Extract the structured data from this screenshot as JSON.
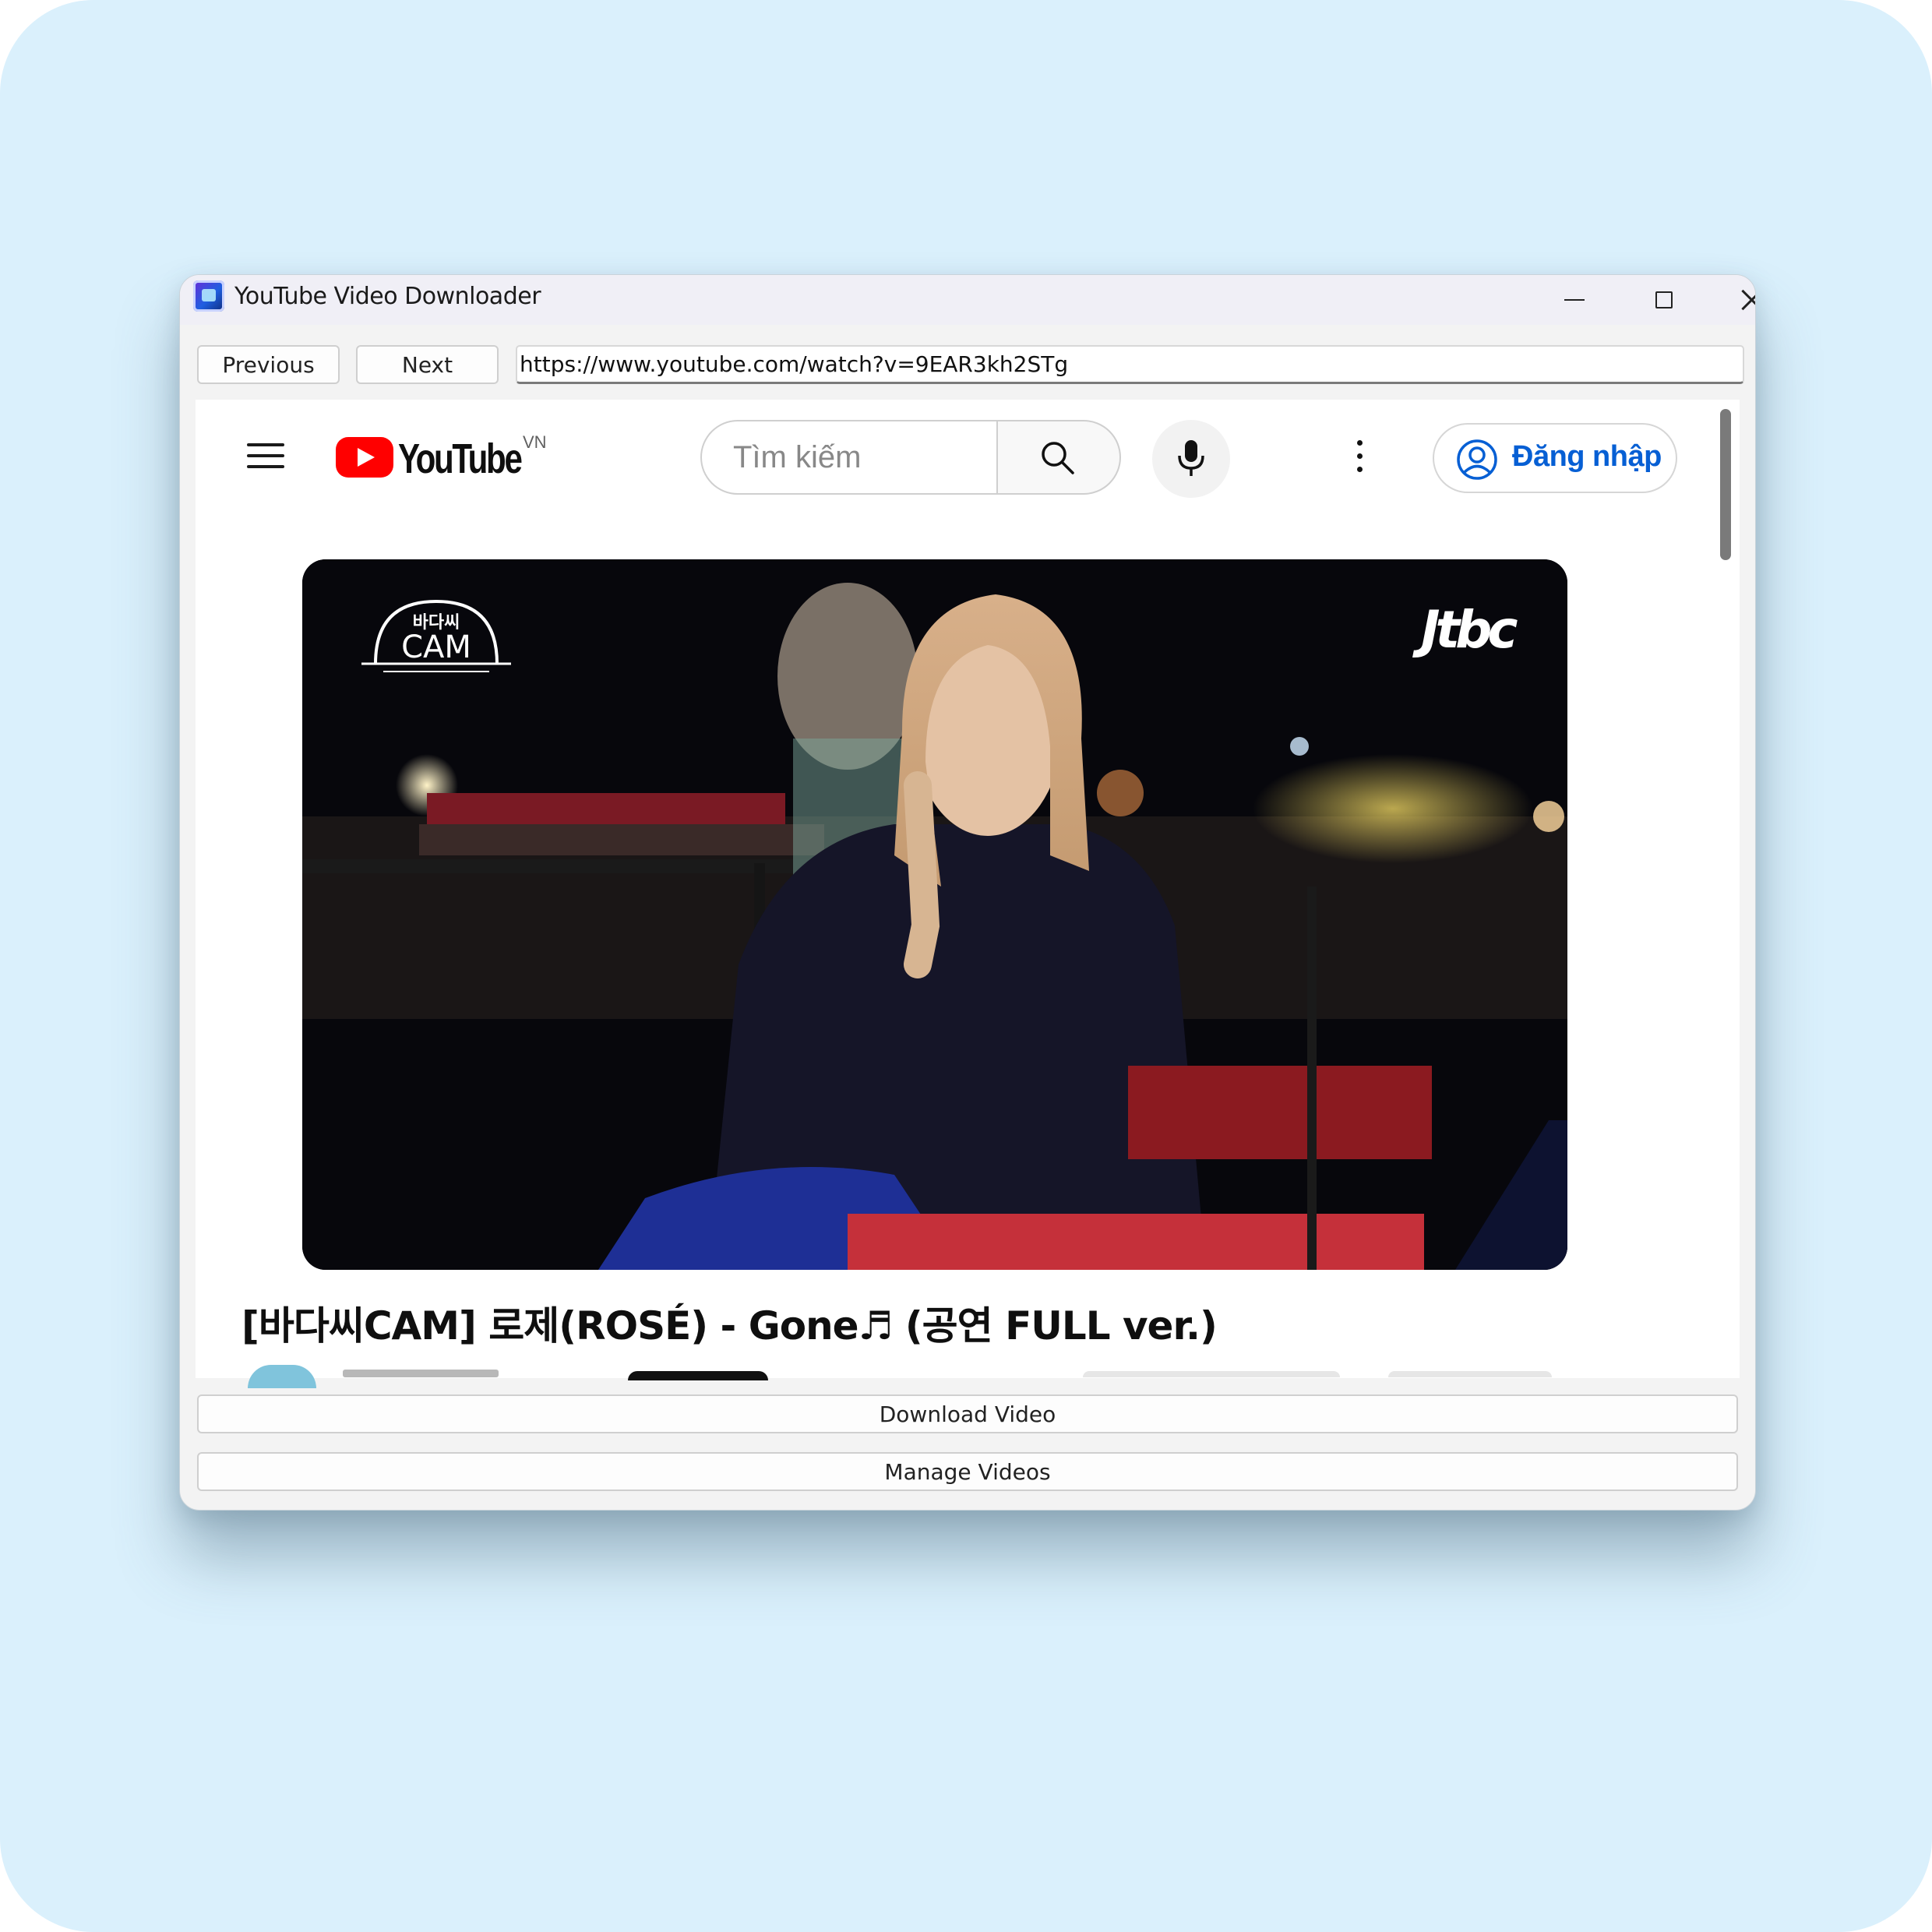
{
  "window": {
    "title": "YouTube Video Downloader"
  },
  "toolbar": {
    "previous_label": "Previous",
    "next_label": "Next",
    "url_value": "https://www.youtube.com/watch?v=9EAR3kh2STg"
  },
  "youtube": {
    "wordmark": "YouTube",
    "country_code": "VN",
    "search_placeholder": "Tìm kiếm",
    "signin_label": "Đăng nhập",
    "video_overlay_left": "바다씨 CAM",
    "video_overlay_right": "Jtbc",
    "video_title": "[바다씨CAM] 로제(ROSÉ) - Gone♬ (공연 FULL ver.)"
  },
  "actions": {
    "download_label": "Download Video",
    "manage_label": "Manage Videos"
  },
  "colors": {
    "background": "#daf0fc",
    "youtube_red": "#ff0000",
    "link_blue": "#065fd4"
  },
  "icons": [
    "app-icon",
    "minimize-icon",
    "maximize-icon",
    "close-icon",
    "hamburger-menu-icon",
    "youtube-logo",
    "search-icon",
    "microphone-icon",
    "more-vertical-icon",
    "user-account-icon"
  ]
}
